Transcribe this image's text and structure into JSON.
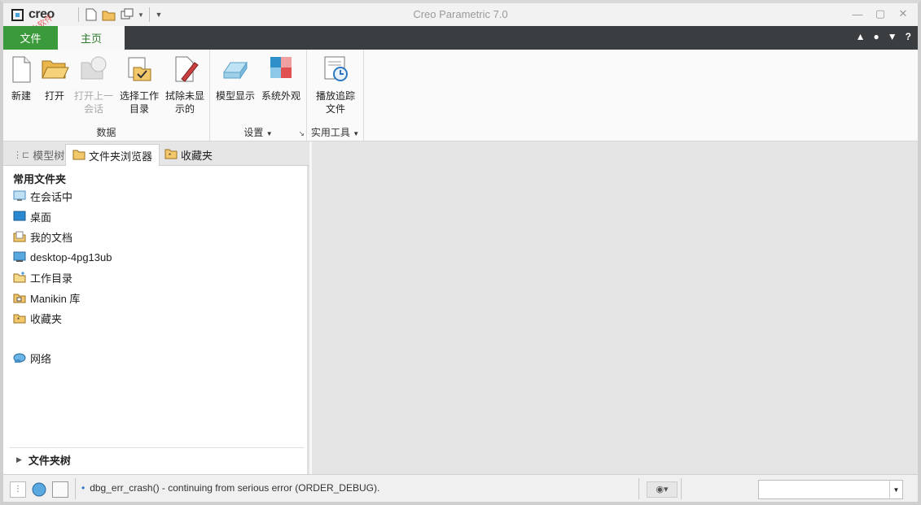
{
  "app": {
    "logo_text": "creo",
    "window_title": "Creo Parametric 7.0",
    "watermark": "公众号 小软件"
  },
  "window_controls": {
    "minimize": "—",
    "maximize": "▢",
    "close": "✕"
  },
  "tabs": {
    "file": "文件",
    "home": "主页"
  },
  "ribbon": {
    "data_group": {
      "label": "数据",
      "new": "新建",
      "open": "打开",
      "open_last_1": "打开上一",
      "open_last_2": "会话",
      "select_dir_1": "选择工作",
      "select_dir_2": "目录",
      "erase_1": "拭除未显",
      "erase_2": "示的"
    },
    "settings_group": {
      "label": "设置",
      "model_display": "模型显示",
      "system_appearance": "系统外观"
    },
    "utilities_group": {
      "label": "实用工具",
      "playback_1": "播放追踪",
      "playback_2": "文件"
    }
  },
  "panel": {
    "tabs": {
      "model_tree": "模型树",
      "folder_browser": "文件夹浏览器",
      "favorites": "收藏夹"
    },
    "section_title": "常用文件夹",
    "items": [
      {
        "label": "在会话中"
      },
      {
        "label": "桌面"
      },
      {
        "label": "我的文档"
      },
      {
        "label": "desktop-4pg13ub"
      },
      {
        "label": "工作目录"
      },
      {
        "label": "Manikin 库"
      },
      {
        "label": "收藏夹"
      }
    ],
    "network": "网络",
    "folder_tree": "文件夹树"
  },
  "status": {
    "message": "dbg_err_crash() - continuing from serious error (ORDER_DEBUG)."
  }
}
